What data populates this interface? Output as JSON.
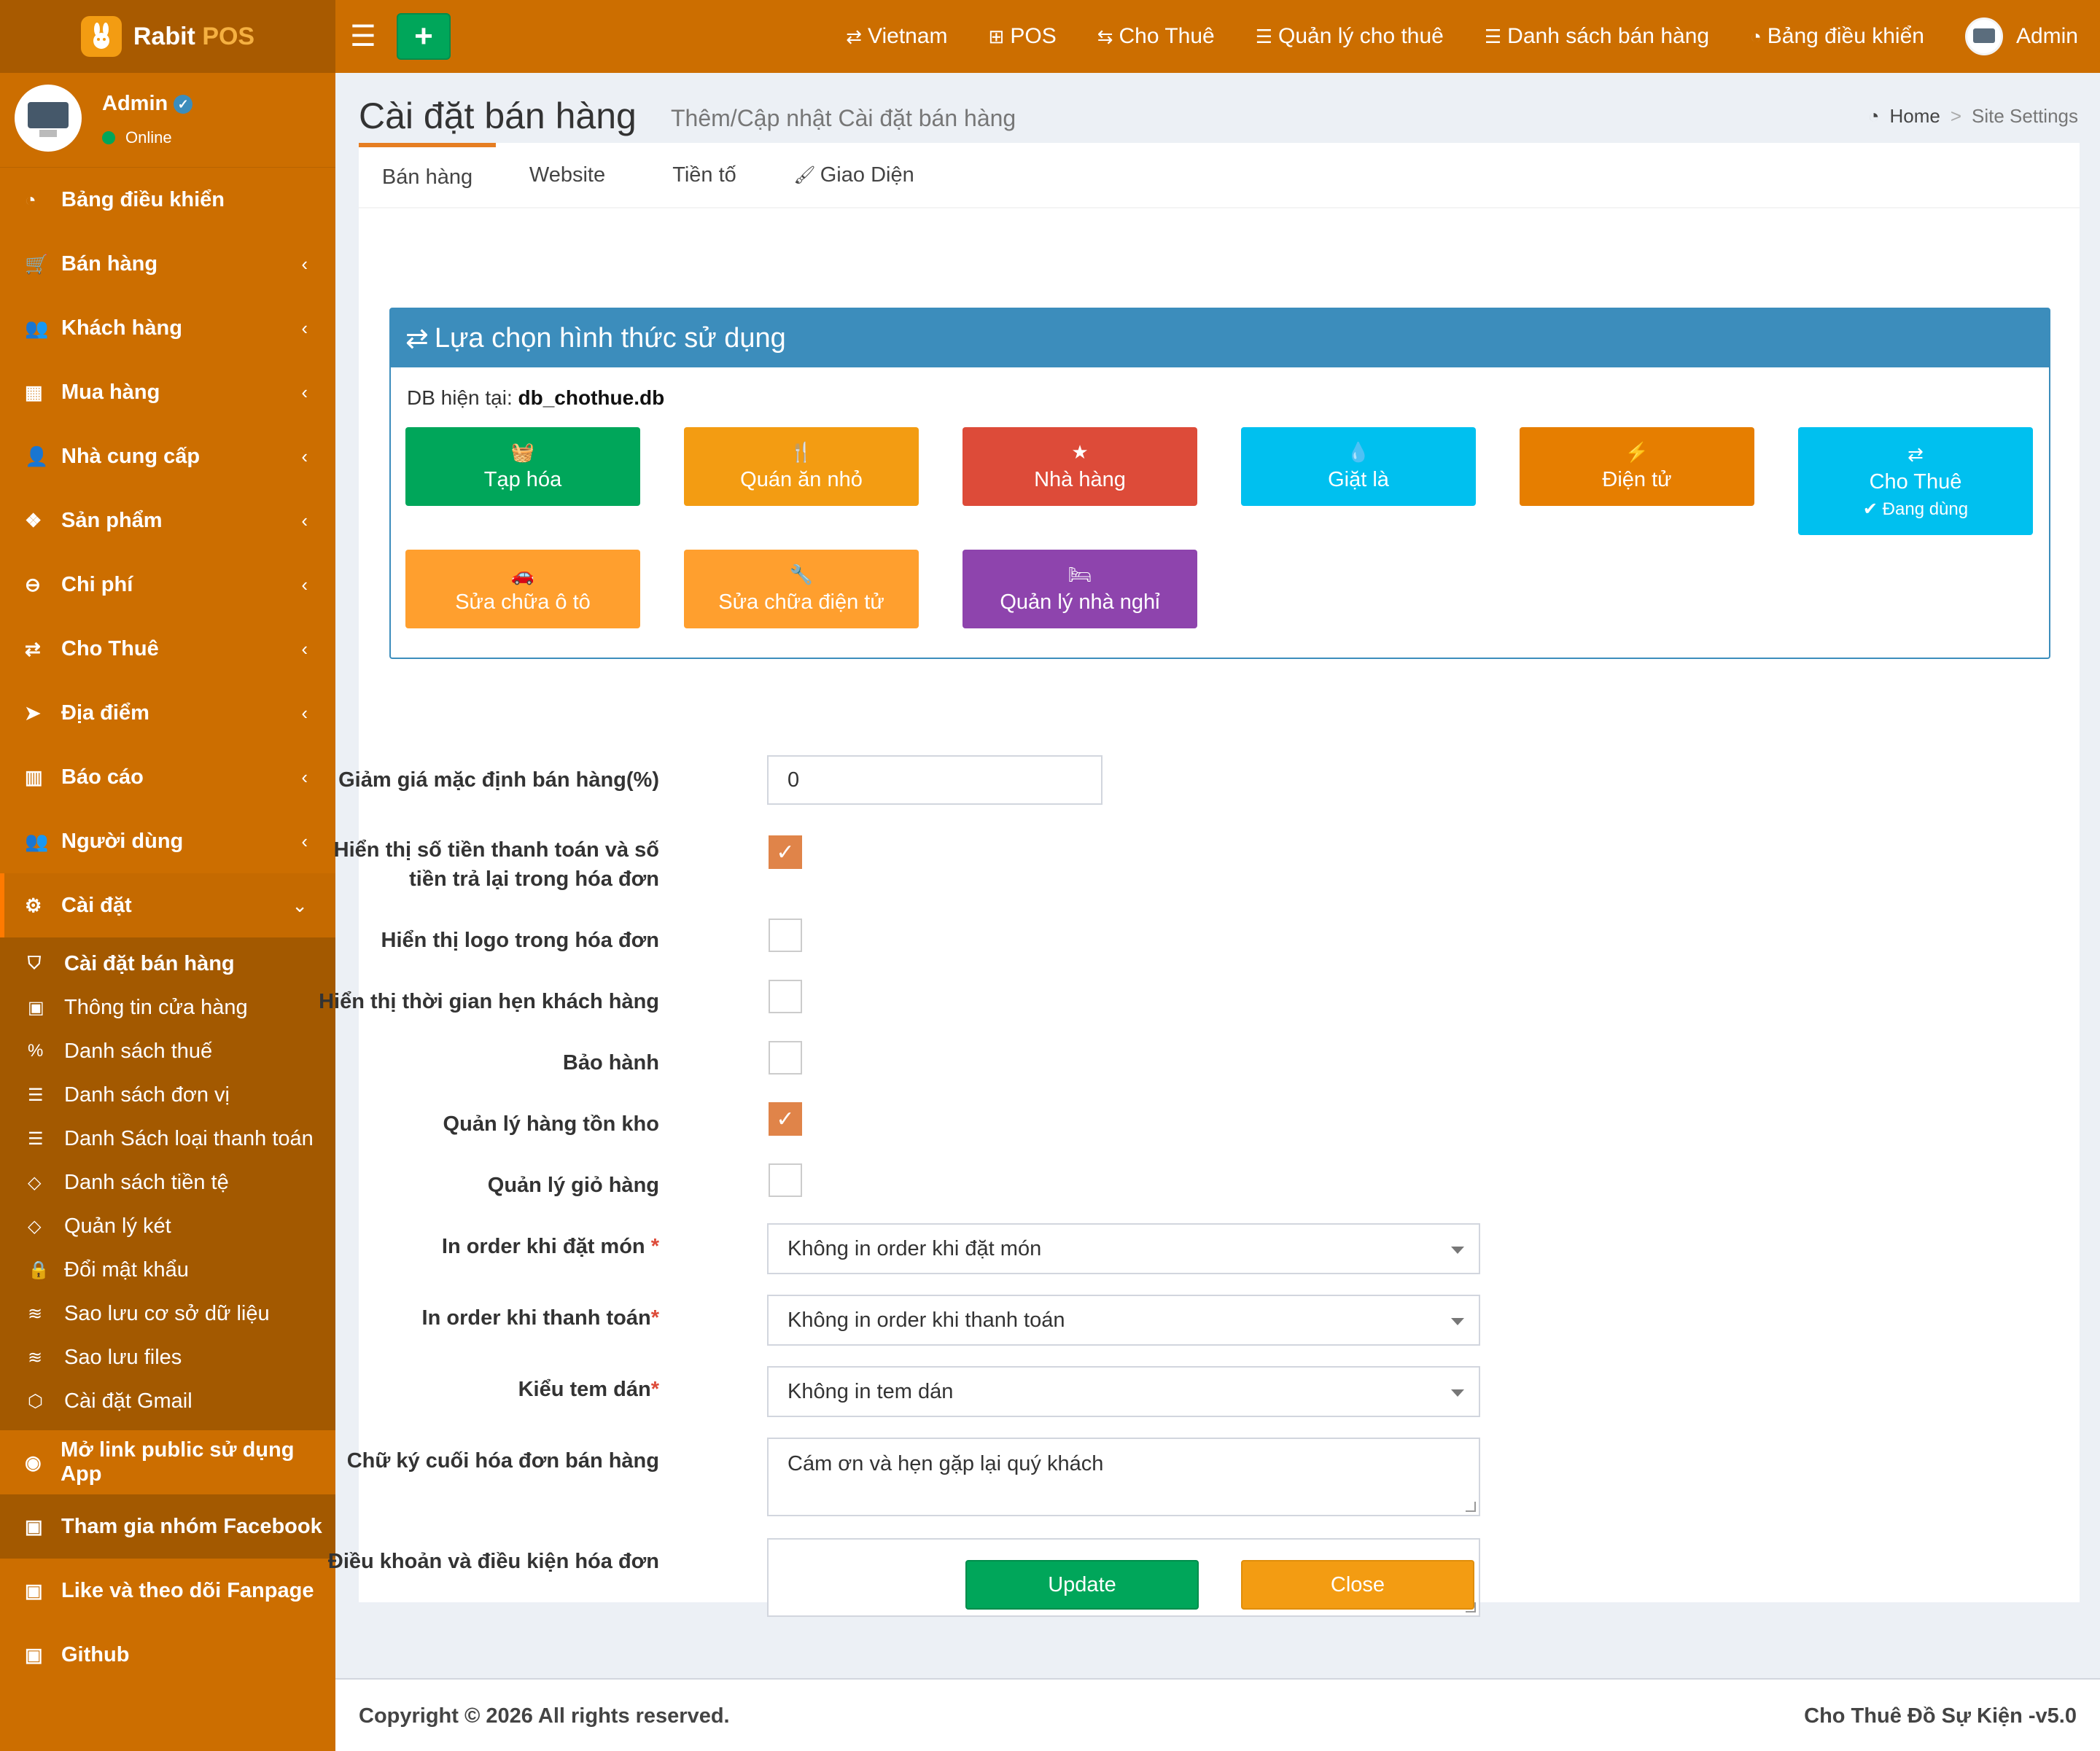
{
  "app": {
    "brand_main": "Rabit",
    "brand_accent": "POS",
    "add_icon": "+"
  },
  "topnav": [
    {
      "icon": "language-icon",
      "glyph": "⇄",
      "label": "Vietnam"
    },
    {
      "icon": "plus-square-icon",
      "glyph": "⊞",
      "label": "POS"
    },
    {
      "icon": "exchange-icon",
      "glyph": "⇆",
      "label": "Cho Thuê"
    },
    {
      "icon": "list-icon",
      "glyph": "☰",
      "label": "Quản lý cho thuê"
    },
    {
      "icon": "list-icon",
      "glyph": "☰",
      "label": "Danh sách bán hàng"
    },
    {
      "icon": "dashboard-icon",
      "glyph": "◔",
      "label": "Bảng điều khiển"
    }
  ],
  "top_user": "Admin",
  "user": {
    "name": "Admin",
    "status": "Online"
  },
  "menu": [
    {
      "icon": "dashboard-icon",
      "glyph": "◔",
      "label": "Bảng điều khiển",
      "chev": ""
    },
    {
      "icon": "cart-icon",
      "glyph": "🛒",
      "label": "Bán hàng",
      "chev": "‹"
    },
    {
      "icon": "users-icon",
      "glyph": "👥",
      "label": "Khách hàng",
      "chev": "‹"
    },
    {
      "icon": "grid-icon",
      "glyph": "▦",
      "label": "Mua hàng",
      "chev": "‹"
    },
    {
      "icon": "user-plus-icon",
      "glyph": "👤",
      "label": "Nhà cung cấp",
      "chev": "‹"
    },
    {
      "icon": "cubes-icon",
      "glyph": "❖",
      "label": "Sản phẩm",
      "chev": "‹"
    },
    {
      "icon": "minus-circle-icon",
      "glyph": "⊖",
      "label": "Chi phí",
      "chev": "‹"
    },
    {
      "icon": "exchange-icon",
      "glyph": "⇄",
      "label": "Cho Thuê",
      "chev": "‹"
    },
    {
      "icon": "send-icon",
      "glyph": "➤",
      "label": "Địa điểm",
      "chev": "‹"
    },
    {
      "icon": "bar-chart-icon",
      "glyph": "▥",
      "label": "Báo cáo",
      "chev": "‹"
    },
    {
      "icon": "users-icon",
      "glyph": "👥",
      "label": "Người dùng",
      "chev": "‹"
    }
  ],
  "settings_menu": {
    "icon": "cogs-icon",
    "glyph": "⚙",
    "label": "Cài đặt",
    "chev": "⌄"
  },
  "settings_sub": [
    {
      "icon": "shield-icon",
      "glyph": "⛉",
      "label": "Cài đặt bán hàng"
    },
    {
      "icon": "briefcase-icon",
      "glyph": "▣",
      "label": "Thông tin cửa hàng"
    },
    {
      "icon": "percent-icon",
      "glyph": "%",
      "label": "Danh sách thuế"
    },
    {
      "icon": "list-icon",
      "glyph": "☰",
      "label": "Danh sách đơn vị"
    },
    {
      "icon": "list-icon",
      "glyph": "☰",
      "label": "Danh Sách loại thanh toán"
    },
    {
      "icon": "code-icon",
      "glyph": "◇",
      "label": "Danh sách tiền tệ"
    },
    {
      "icon": "code-icon",
      "glyph": "◇",
      "label": "Quản lý két"
    },
    {
      "icon": "lock-icon",
      "glyph": "🔒",
      "label": "Đổi mật khẩu"
    },
    {
      "icon": "database-icon",
      "glyph": "≋",
      "label": "Sao lưu cơ sở dữ liệu"
    },
    {
      "icon": "database-icon",
      "glyph": "≋",
      "label": "Sao lưu files"
    },
    {
      "icon": "cube-icon",
      "glyph": "⬡",
      "label": "Cài đặt Gmail"
    }
  ],
  "extra_menu": [
    {
      "icon": "globe-icon",
      "glyph": "◉",
      "label": "Mở link public sử dụng App"
    },
    {
      "icon": "briefcase-icon",
      "glyph": "▣",
      "label": "Tham gia nhóm Facebook"
    },
    {
      "icon": "briefcase-icon",
      "glyph": "▣",
      "label": "Like và theo dõi Fanpage"
    },
    {
      "icon": "briefcase-icon",
      "glyph": "▣",
      "label": "Github"
    }
  ],
  "page": {
    "title": "Cài đặt bán hàng",
    "subtitle": "Thêm/Cập nhật Cài đặt bán hàng"
  },
  "breadcrumb": {
    "home": "Home",
    "sep": ">",
    "current": "Site Settings"
  },
  "tabs": [
    {
      "label": "Bán hàng",
      "glyph": ""
    },
    {
      "label": "Website",
      "glyph": ""
    },
    {
      "label": "Tiền tố",
      "glyph": ""
    },
    {
      "label": "Giao Diện",
      "glyph": "🖌"
    }
  ],
  "mode_box": {
    "title": "Lựa chọn hình thức sử dụng",
    "title_glyph": "⇄",
    "db_label": "DB hiện tại:",
    "db_name": "db_chothue.db",
    "options": [
      {
        "label": "Tạp hóa",
        "icon": "basket-icon",
        "glyph": "🧺",
        "color": "#00a65a",
        "note": ""
      },
      {
        "label": "Quán ăn nhỏ",
        "icon": "cutlery-icon",
        "glyph": "🍴",
        "color": "#f39c12",
        "note": ""
      },
      {
        "label": "Nhà hàng",
        "icon": "star-icon",
        "glyph": "★",
        "color": "#dd4b39",
        "note": ""
      },
      {
        "label": "Giặt là",
        "icon": "tint-icon",
        "glyph": "💧",
        "color": "#00c0ef",
        "note": ""
      },
      {
        "label": "Điện tử",
        "icon": "bolt-icon",
        "glyph": "⚡",
        "color": "#e67e00",
        "note": ""
      },
      {
        "label": "Cho Thuê",
        "icon": "exchange-icon",
        "glyph": "⇄",
        "color": "#00c0ef",
        "note": "✔ Đang dùng"
      },
      {
        "label": "Sửa chữa ô tô",
        "icon": "car-icon",
        "glyph": "🚗",
        "color": "#ff9f2e",
        "note": ""
      },
      {
        "label": "Sửa chữa điện tử",
        "icon": "wrench-icon",
        "glyph": "🔧",
        "color": "#ff9f2e",
        "note": ""
      },
      {
        "label": "Quản lý nhà nghỉ",
        "icon": "bed-icon",
        "glyph": "🛏",
        "color": "#8e44ad",
        "note": ""
      }
    ]
  },
  "form": {
    "discount_label": "Giảm giá mặc định bán hàng(%)",
    "discount_value": "0",
    "show_payment_label_1": "Hiển thị số tiền thanh toán và số",
    "show_payment_label_2": "tiền trả lại trong hóa đơn",
    "show_payment_checked": true,
    "show_logo_label": "Hiển thị logo trong hóa đơn",
    "show_logo_checked": false,
    "show_appointment_label": "Hiển thị thời gian hẹn khách hàng",
    "show_appointment_checked": false,
    "warranty_label": "Bảo hành",
    "warranty_checked": false,
    "inventory_label": "Quản lý hàng tồn kho",
    "inventory_checked": true,
    "cart_label": "Quản lý giỏ hàng",
    "cart_checked": false,
    "print_order_label": "In order khi đặt món",
    "print_order_value": "Không in order khi đặt món",
    "print_pay_label": "In order khi thanh toán",
    "print_pay_value": "Không in order khi thanh toán",
    "sticker_label": "Kiểu tem dán",
    "sticker_value": "Không in tem dán",
    "signature_label": "Chữ ký cuối hóa đơn bán hàng",
    "signature_value": "Cám ơn và hẹn gặp lại quý khách",
    "terms_label": "Điều khoản và điều kiện hóa đơn",
    "terms_value": "",
    "required_mark": "*"
  },
  "buttons": {
    "update": "Update",
    "close": "Close"
  },
  "footer": {
    "copyright": "Copyright © 2026 All rights reserved.",
    "version": "Cho Thuê Đồ Sự Kiện -v5.0"
  },
  "colors": {
    "brand": "#cc6e00",
    "accent": "#e67e22",
    "box": "#3c8dbc",
    "success": "#00a65a",
    "warning": "#f39c12"
  }
}
